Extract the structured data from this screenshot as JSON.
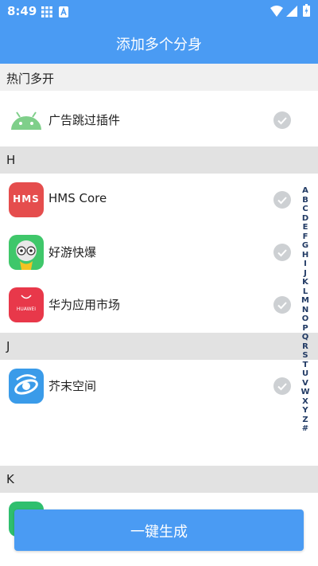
{
  "status_bar": {
    "time": "8:49",
    "icons": [
      "grid-icon",
      "a-icon",
      "wifi-icon",
      "signal-icon",
      "battery-icon"
    ]
  },
  "app_bar": {
    "title": "添加多个分身"
  },
  "sections": [
    {
      "label": "热门多开",
      "apps": [
        {
          "name": "广告跳过插件",
          "icon": "android-icon"
        }
      ]
    },
    {
      "label": "H",
      "apps": [
        {
          "name": "HMS Core",
          "icon": "hms-icon",
          "icon_text": "HMS"
        },
        {
          "name": "好游快爆",
          "icon": "haoyou-icon"
        },
        {
          "name": "华为应用市场",
          "icon": "huawei-appgallery-icon",
          "icon_text": "HUAWEI"
        }
      ]
    },
    {
      "label": "J",
      "apps": [
        {
          "name": "芥末空间",
          "icon": "jiemo-icon"
        }
      ]
    },
    {
      "label": "K",
      "apps": []
    }
  ],
  "alphabet_index": [
    "A",
    "B",
    "C",
    "D",
    "E",
    "F",
    "G",
    "H",
    "I",
    "J",
    "K",
    "L",
    "M",
    "N",
    "O",
    "P",
    "Q",
    "R",
    "S",
    "T",
    "U",
    "V",
    "W",
    "X",
    "Y",
    "Z",
    "#"
  ],
  "generate_button": {
    "label": "一键生成"
  },
  "colors": {
    "primary": "#4a9bf3",
    "section_bg": "#e2e2e2",
    "check_gray": "#cdd0d3",
    "index_text": "#213a64"
  }
}
